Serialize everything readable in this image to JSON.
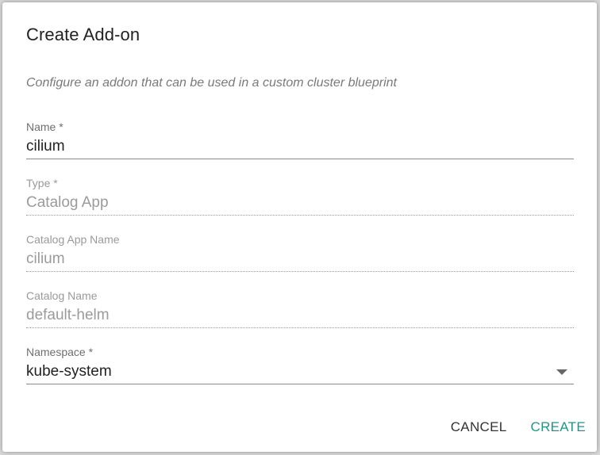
{
  "dialog": {
    "title": "Create Add-on",
    "subtitle": "Configure an addon that can be used in a custom cluster blueprint"
  },
  "fields": {
    "name": {
      "label": "Name *",
      "value": "cilium"
    },
    "type": {
      "label": "Type *",
      "value": "Catalog App"
    },
    "catalog_app_name": {
      "label": "Catalog App Name",
      "value": "cilium"
    },
    "catalog_name": {
      "label": "Catalog Name",
      "value": "default-helm"
    },
    "namespace": {
      "label": "Namespace *",
      "value": "kube-system"
    }
  },
  "actions": {
    "cancel_label": "CANCEL",
    "create_label": "CREATE"
  },
  "colors": {
    "accent": "#1a9a86",
    "text": "#222222",
    "muted": "#9b9b9b"
  },
  "icons": {
    "namespace_dropdown": "chevron-down-icon"
  }
}
